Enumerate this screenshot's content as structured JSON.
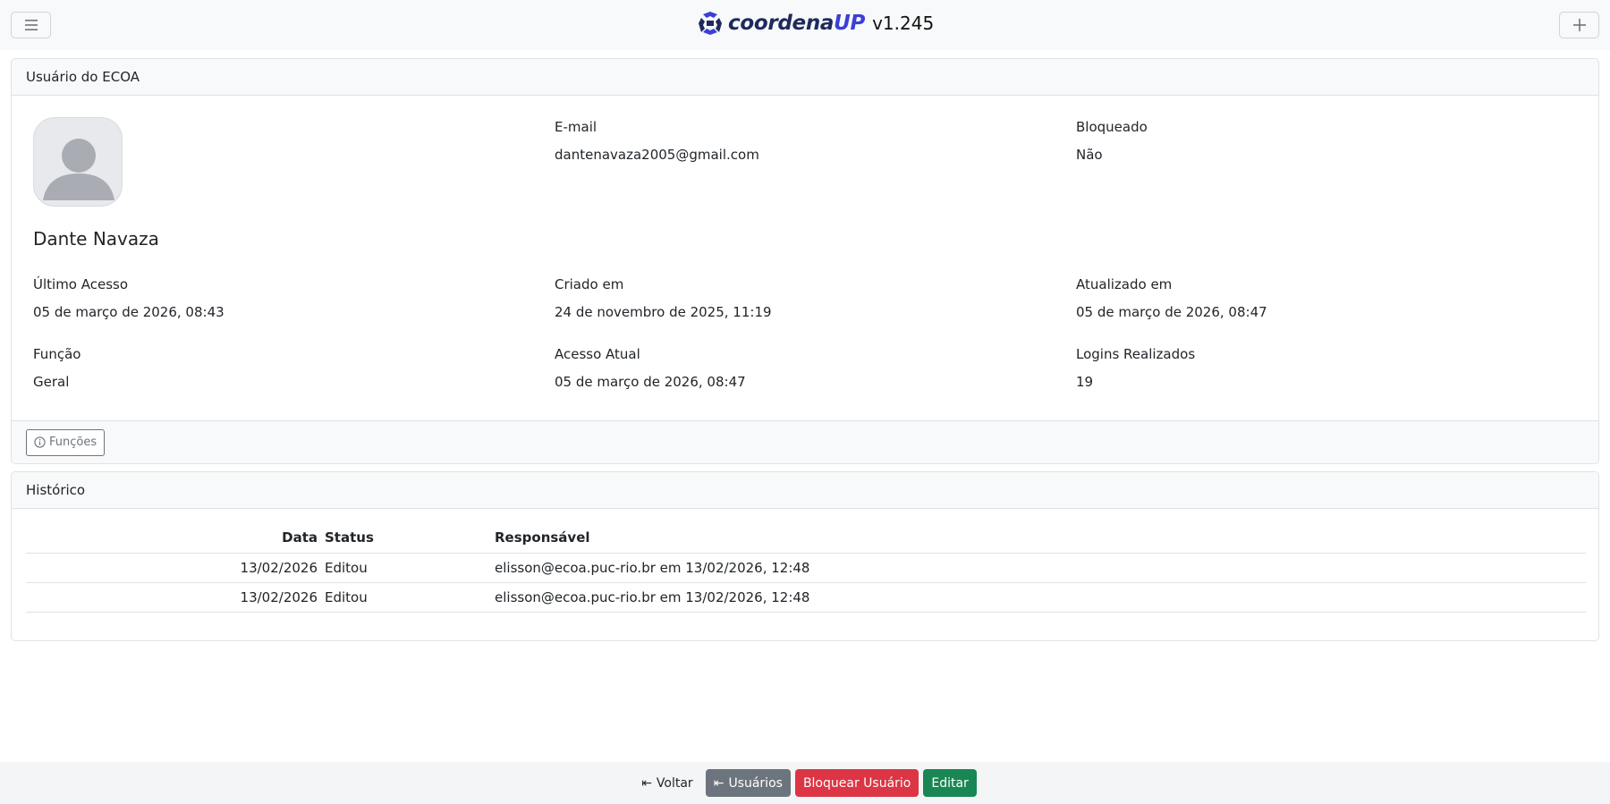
{
  "app": {
    "brand_main": "coordena",
    "brand_accent": "UP",
    "version": "v1.245",
    "accent_color": "#3b3fd8"
  },
  "user_card": {
    "title": "Usuário do ECOA",
    "name": "Dante Navaza",
    "fields": {
      "email": {
        "label": "E-mail",
        "value": "dantenavaza2005@gmail.com"
      },
      "blocked": {
        "label": "Bloqueado",
        "value": "Não"
      },
      "last_access": {
        "label": "Último Acesso",
        "value": "05 de março de 2026, 08:43"
      },
      "created": {
        "label": "Criado em",
        "value": "24 de novembro de 2025, 11:19"
      },
      "updated": {
        "label": "Atualizado em",
        "value": "05 de março de 2026, 08:47"
      },
      "role": {
        "label": "Função",
        "value": "Geral"
      },
      "current_access": {
        "label": "Acesso Atual",
        "value": "05 de março de 2026, 08:47"
      },
      "logins": {
        "label": "Logins Realizados",
        "value": "19"
      }
    },
    "functions_button": "Funções"
  },
  "history": {
    "title": "Histórico",
    "columns": [
      "Data",
      "Status",
      "Responsável"
    ],
    "rows": [
      [
        "13/02/2026",
        "Editou",
        "elisson@ecoa.puc-rio.br em 13/02/2026, 12:48"
      ],
      [
        "13/02/2026",
        "Editou",
        "elisson@ecoa.puc-rio.br em 13/02/2026, 12:48"
      ]
    ]
  },
  "actions": {
    "back": "Voltar",
    "users": "Usuários",
    "block": "Bloquear Usuário",
    "edit": "Editar"
  },
  "icons": [
    "menu-icon",
    "plus-icon",
    "info-icon",
    "back-arrow-icon"
  ]
}
